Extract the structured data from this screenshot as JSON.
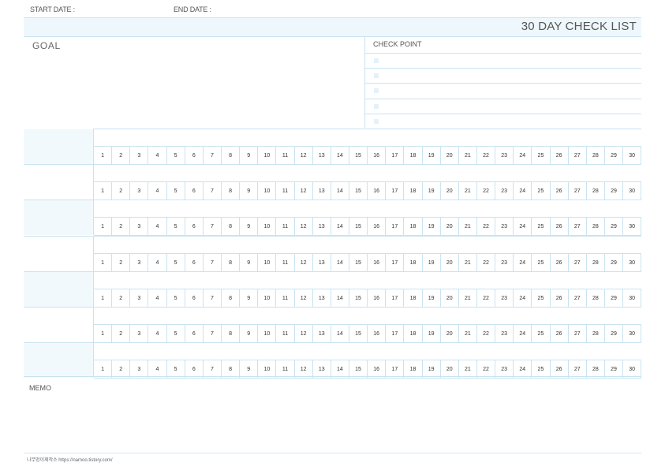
{
  "header": {
    "start_date_label": "START DATE :",
    "end_date_label": "END DATE :",
    "title": "30 DAY CHECK LIST"
  },
  "goal": {
    "label": "GOAL"
  },
  "checkpoint": {
    "label": "CHECK POINT",
    "items": 5
  },
  "tracker": {
    "rows": 7,
    "days": [
      "1",
      "2",
      "3",
      "4",
      "5",
      "6",
      "7",
      "8",
      "9",
      "10",
      "11",
      "12",
      "13",
      "14",
      "15",
      "16",
      "17",
      "18",
      "19",
      "20",
      "21",
      "22",
      "23",
      "24",
      "25",
      "26",
      "27",
      "28",
      "29",
      "30"
    ]
  },
  "memo": {
    "label": "MEMO"
  },
  "footer": {
    "credit": "나무멍이제작소   https://namoo.tistory.com/"
  },
  "colors": {
    "line": "#c9e3f1",
    "header_bg": "#eef7fc",
    "name_bg": "#f2f9fd"
  }
}
